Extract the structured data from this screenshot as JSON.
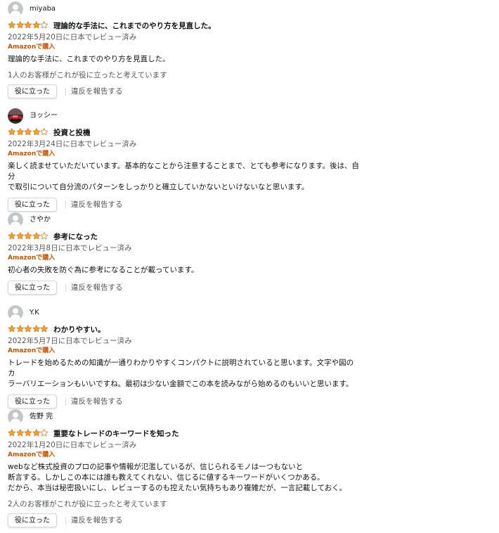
{
  "colors": {
    "star_fill": "#f0a324",
    "star_border": "#de7921",
    "verified": "#c45500",
    "muted_text": "#565959"
  },
  "reviews": [
    {
      "author": "miyaba",
      "avatar": "default-avatar",
      "rating": 4,
      "title": "理論的な手法に、これまでのやり方を見直した。",
      "date": "2022年5月20日に日本でレビュー済み",
      "verified": "Amazonで購入",
      "body": "理論的な手法に、これまでのやり方を見直した。",
      "helpful_count": "1人のお客様がこれが役に立ったと考えています",
      "helpful_button": "役に立った",
      "report": "違反を報告する"
    },
    {
      "author": "ヨッシー",
      "avatar": "photo-avatar",
      "rating": 4,
      "title": "投資と投機",
      "date": "2022年3月24日に日本でレビュー済み",
      "verified": "Amazonで購入",
      "body": "楽しく読ませていただいています。基本的なことから注意することまで、とても参考になります。後は、自分\nで取引について自分流のパターンをしっかりと確立していかないといけないなと思います。",
      "helpful_count": "",
      "helpful_button": "役に立った",
      "report": "違反を報告する"
    },
    {
      "author": "さやか",
      "avatar": "default-avatar",
      "rating": 4,
      "title": "参考になった",
      "date": "2022年3月8日に日本でレビュー済み",
      "verified": "Amazonで購入",
      "body": "初心者の失敗を防ぐ為に参考になることが載っています。",
      "helpful_count": "",
      "helpful_button": "役に立った",
      "report": "違反を報告する"
    },
    {
      "author": "Y.K",
      "avatar": "default-avatar",
      "rating": 5,
      "title": "わかりやすい。",
      "date": "2022年5月7日に日本でレビュー済み",
      "verified": "Amazonで購入",
      "body": "トレードを始めるための知識が一通りわかりやすくコンパクトに説明されていると思います。文字や図のカ\nラーバリエーションもいいですね。最初は少ない金額でこの本を読みながら始めるのもいいと思います。",
      "helpful_count": "",
      "helpful_button": "役に立った",
      "report": "違反を報告する"
    },
    {
      "author": "佐野 完",
      "avatar": "default-avatar",
      "rating": 4,
      "title": "重要なトレードのキーワードを知った",
      "date": "2022年1月20日に日本でレビュー済み",
      "verified": "Amazonで購入",
      "body": "webなど株式投資のプロの記事や情報が氾濫しているが、信じられるモノは一つもないと\n断言する。しかしこの本には誰も教えてくれない、信じるに値するキーワードがいくつかある。\nだから、本当は秘密扱いにし、レビューするのも控えたい気持ちもあり複雑だが、一言記載しておく。",
      "helpful_count": "2人のお客様がこれが役に立ったと考えています",
      "helpful_button": "役に立った",
      "report": "違反を報告する"
    }
  ]
}
